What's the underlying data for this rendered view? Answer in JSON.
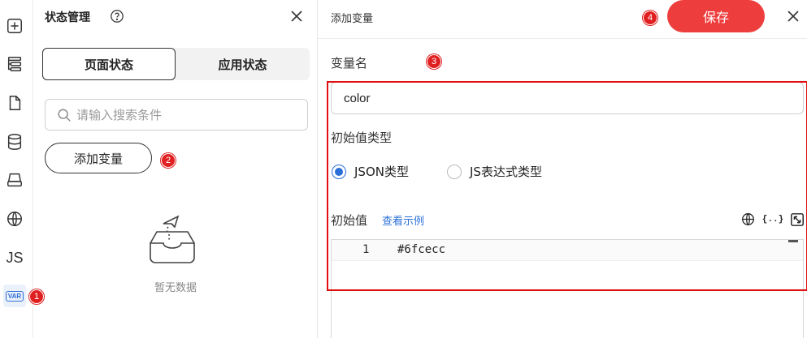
{
  "rail": {
    "js_label": "JS",
    "var_label": "VAR",
    "markers": {
      "var": "1"
    }
  },
  "state_panel": {
    "title": "状态管理",
    "tabs": [
      {
        "label": "页面状态",
        "active": true
      },
      {
        "label": "应用状态",
        "active": false
      }
    ],
    "search_placeholder": "请输入搜索条件",
    "add_button_label": "添加变量",
    "add_marker": "2",
    "empty_text": "暂无数据"
  },
  "editor": {
    "title": "添加变量",
    "save_label": "保存",
    "save_marker": "4",
    "name_label": "变量名",
    "name_marker": "3",
    "name_value": "color",
    "type_label": "初始值类型",
    "types": [
      {
        "label": "JSON类型",
        "checked": true
      },
      {
        "label": "JS表达式类型",
        "checked": false
      }
    ],
    "init_label": "初始值",
    "example_link": "查看示例",
    "brace_icon_text": "{..}",
    "code": {
      "line_number": "1",
      "content": "#6fcecc"
    }
  },
  "colors": {
    "save": "#ee3d3d",
    "accent": "#2a6fd8",
    "marker": "#e02020",
    "highlight_box": "#e01010"
  }
}
